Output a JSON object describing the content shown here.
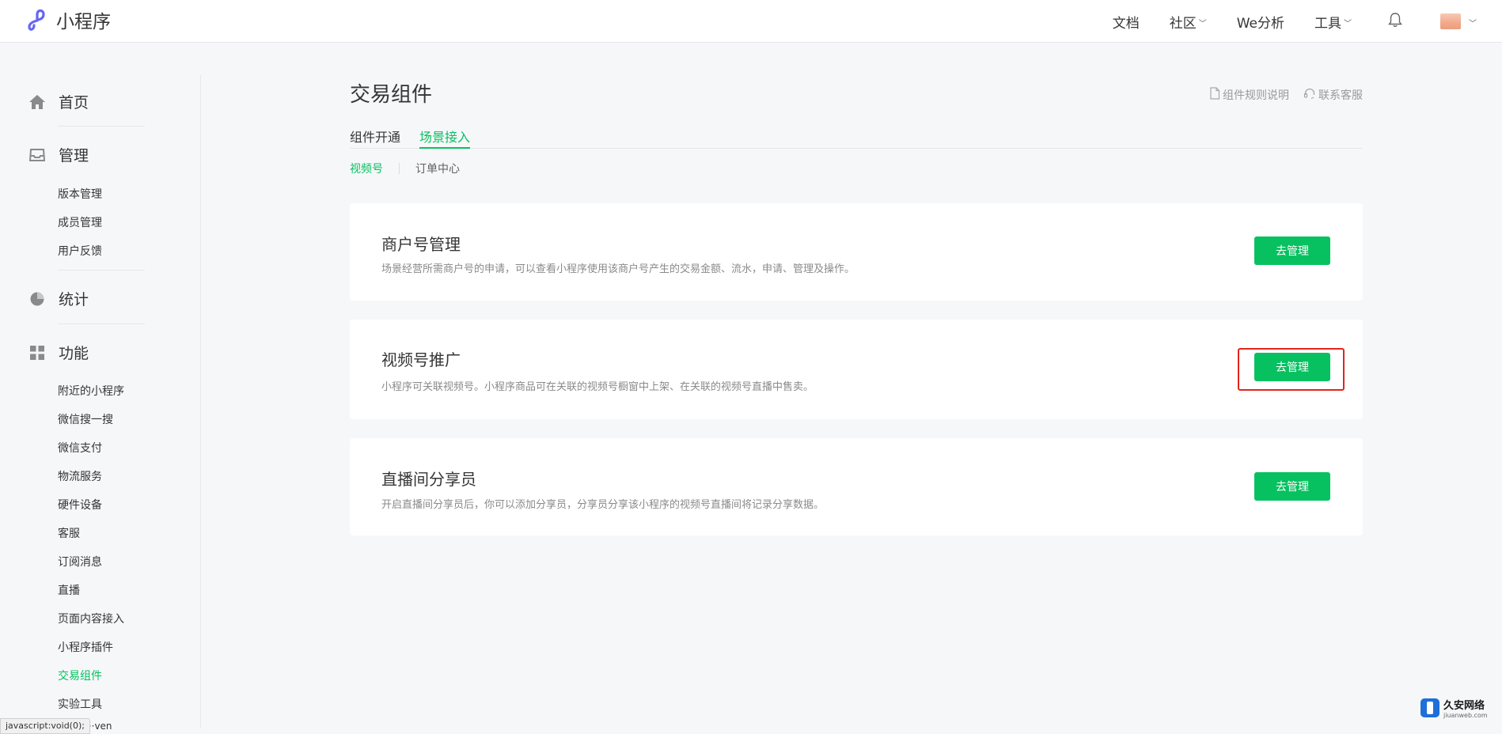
{
  "header": {
    "app_title": "小程序",
    "nav": [
      {
        "label": "文档",
        "dropdown": false
      },
      {
        "label": "社区",
        "dropdown": true
      },
      {
        "label": "We分析",
        "dropdown": false
      },
      {
        "label": "工具",
        "dropdown": true
      }
    ],
    "icons": [
      "miniprogram-logo-icon",
      "bell-icon",
      "avatar",
      "chevron-down-icon"
    ]
  },
  "sidebar": {
    "groups": [
      {
        "label": "首页",
        "icon": "home-icon"
      },
      {
        "label": "管理",
        "icon": "inbox-icon"
      },
      {
        "label": "统计",
        "icon": "pie-chart-icon"
      },
      {
        "label": "功能",
        "icon": "grid-icon"
      }
    ],
    "manage_items": [
      "版本管理",
      "成员管理",
      "用户反馈"
    ],
    "feature_items": [
      "附近的小程序",
      "微信搜一搜",
      "微信支付",
      "物流服务",
      "硬件设备",
      "客服",
      "订阅消息",
      "直播",
      "页面内容接入",
      "小程序插件",
      "交易组件",
      "实验工具"
    ],
    "active_item": "交易组件",
    "partial_item": "···ven",
    "status_text": "javascript:void(0);"
  },
  "main": {
    "title": "交易组件",
    "help_links": [
      "组件规则说明",
      "联系客服"
    ],
    "tabs": [
      "组件开通",
      "场景接入"
    ],
    "active_tab": "场景接入",
    "subtabs": [
      "视频号",
      "订单中心"
    ],
    "active_subtab": "视频号",
    "cards": [
      {
        "title": "商户号管理",
        "desc": "场景经营所需商户号的申请，可以查看小程序使用该商户号产生的交易金额、流水，申请、管理及操作。",
        "button": "去管理"
      },
      {
        "title": "视频号推广",
        "desc": "小程序可关联视频号。小程序商品可在关联的视频号橱窗中上架、在关联的视频号直播中售卖。",
        "button": "去管理",
        "highlighted": true
      },
      {
        "title": "直播间分享员",
        "desc": "开启直播间分享员后，你可以添加分享员，分享员分享该小程序的视频号直播间将记录分享数据。",
        "button": "去管理"
      }
    ]
  },
  "colors": {
    "accent": "#07c160",
    "highlight": "#e1251b",
    "background": "#f6f7f9"
  },
  "watermark": {
    "cn": "久安网络",
    "en": "jiuanweb.com"
  }
}
